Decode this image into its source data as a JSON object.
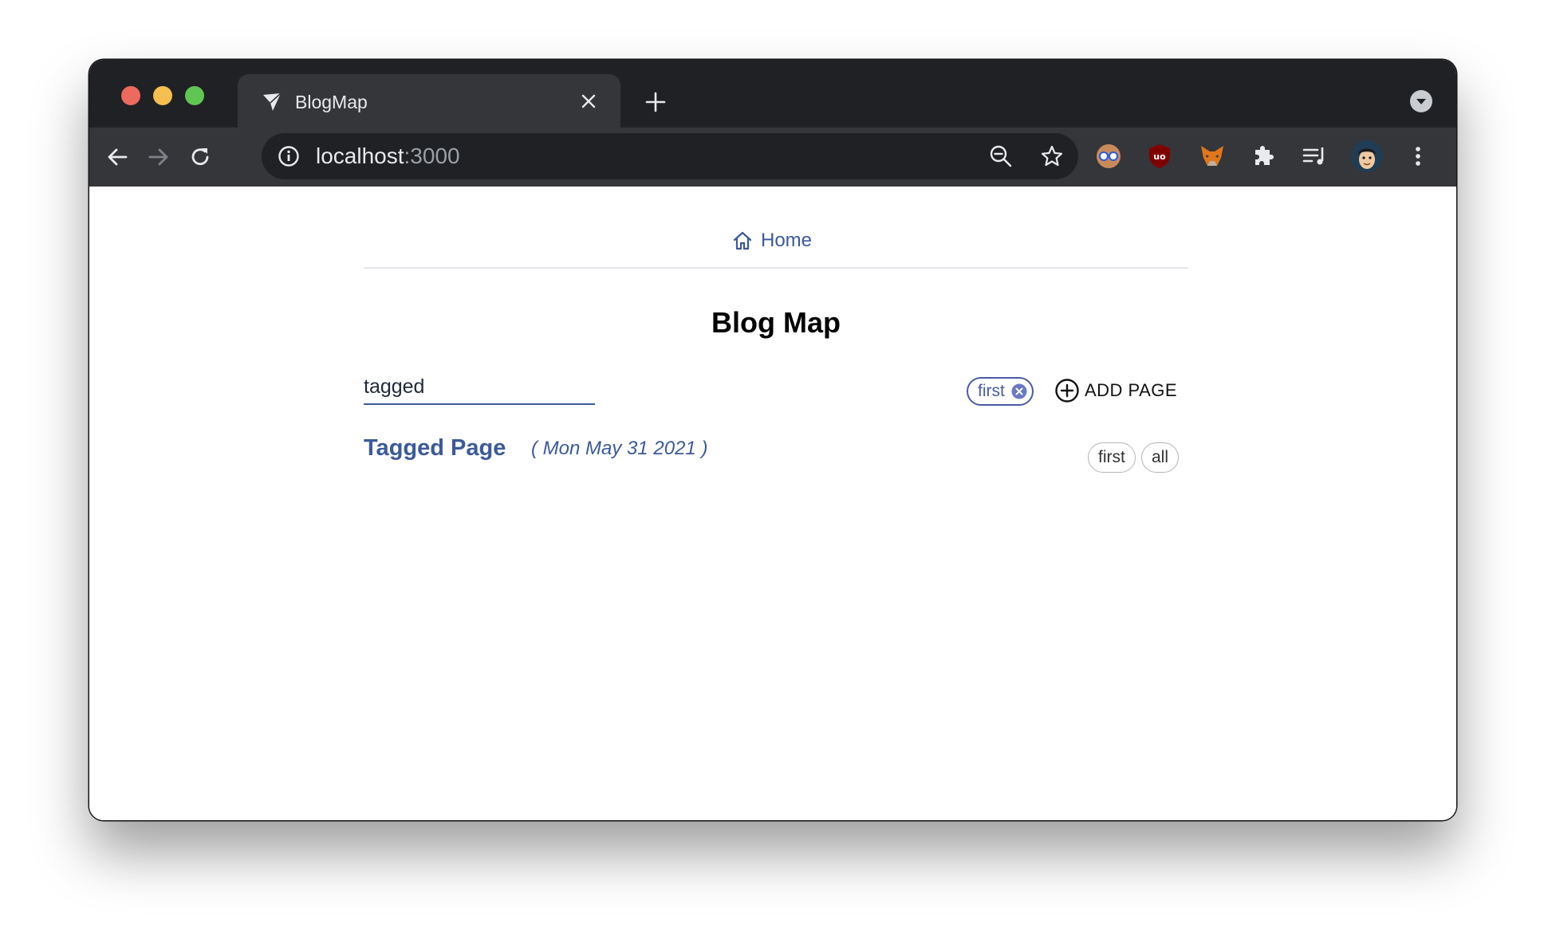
{
  "browser": {
    "tab_title": "BlogMap",
    "url_host": "localhost",
    "url_port": ":3000"
  },
  "nav": {
    "home_label": "Home"
  },
  "page": {
    "title": "Blog Map",
    "search_value": "tagged",
    "active_filter": "first",
    "add_page_label": "ADD PAGE"
  },
  "posts": [
    {
      "title": "Tagged Page",
      "date": "( Mon May 31 2021 )",
      "tags": [
        "first",
        "all"
      ]
    }
  ],
  "colors": {
    "accent": "#3c5a9a",
    "chip": "#4a5aa8",
    "browser_frame": "#202124",
    "browser_toolbar": "#35363a"
  }
}
